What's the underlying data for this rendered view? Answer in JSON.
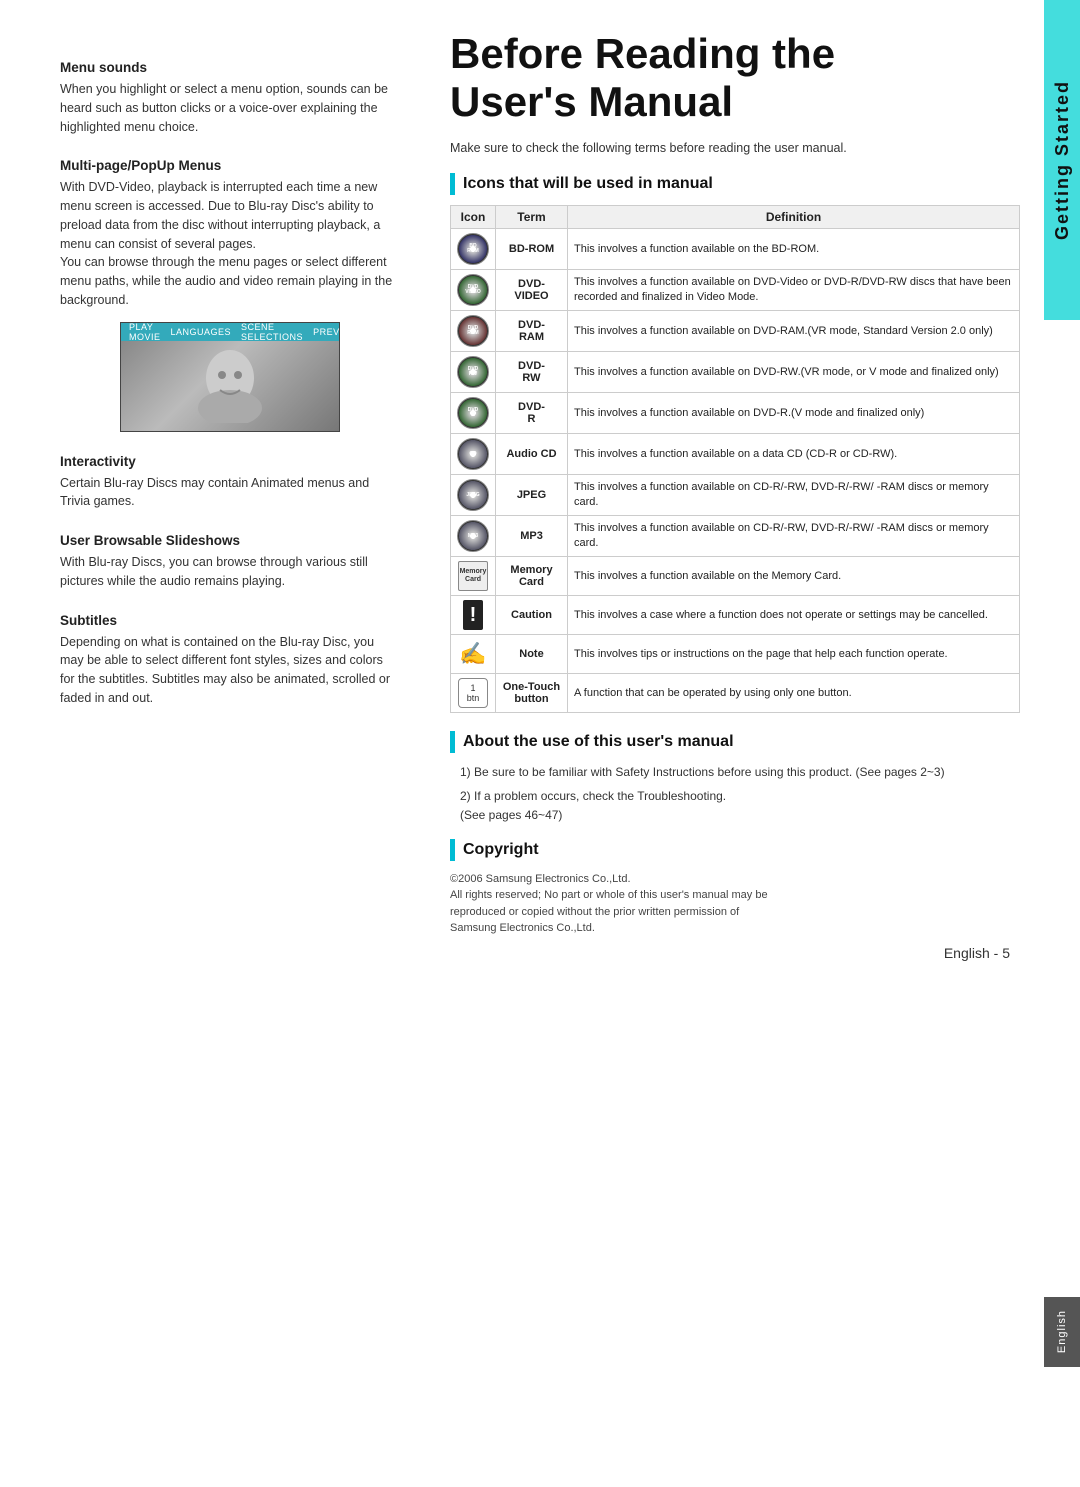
{
  "left": {
    "menu_sounds_title": "Menu sounds",
    "menu_sounds_text": "When you highlight or select a menu option, sounds can be heard such as button clicks or a voice-over explaining the highlighted menu choice.",
    "multipage_title": "Multi-page/PopUp Menus",
    "multipage_text": "With DVD-Video, playback is interrupted each time a new menu screen is accessed. Due to Blu-ray Disc's ability to preload data from the disc without interrupting playback, a menu can consist of several pages.\nYou can browse through the menu pages or select different menu paths, while the audio and video remain playing in the background.",
    "menu_bar_items": [
      "PLAY MOVIE",
      "LANGUAGES",
      "SCENE SELECTIONS",
      "PREVIEWS"
    ],
    "interactivity_title": "Interactivity",
    "interactivity_text": "Certain Blu-ray Discs may contain Animated menus and Trivia games.",
    "slideshows_title": "User Browsable Slideshows",
    "slideshows_text": "With Blu-ray Discs, you can browse through various still pictures while the audio remains playing.",
    "subtitles_title": "Subtitles",
    "subtitles_text": "Depending on what is contained on the Blu-ray Disc, you may be able to select different font styles, sizes and colors for the subtitles. Subtitles may also be animated, scrolled or faded in and out."
  },
  "right": {
    "page_title": "Before Reading the\nUser's Manual",
    "intro_text": "Make sure to check the following terms before reading the user manual.",
    "icons_section_title": "Icons that will be used in manual",
    "table_headers": [
      "Icon",
      "Term",
      "Definition"
    ],
    "table_rows": [
      {
        "icon_label": "BD-ROM",
        "term": "BD-ROM",
        "definition": "This involves a function available on the BD-ROM."
      },
      {
        "icon_label": "DVD-VIDEO",
        "term": "DVD-VIDEO",
        "definition": "This involves a function available on DVD-Video or DVD-R/DVD-RW discs that have been recorded and finalized in Video Mode."
      },
      {
        "icon_label": "DVD-RAM",
        "term": "DVD-\nRAM",
        "definition": "This involves a function available on DVD-RAM.(VR mode, Standard Version 2.0 only)"
      },
      {
        "icon_label": "DVD-RW",
        "term": "DVD-\nRW",
        "definition": "This involves a function available on DVD-RW.(VR mode, or V mode and finalized only)"
      },
      {
        "icon_label": "DVD-R",
        "term": "DVD-\nR",
        "definition": "This involves a function available on DVD-R.(V mode and finalized only)"
      },
      {
        "icon_label": "CD",
        "term": "Audio CD",
        "definition": "This involves a function available on a data CD (CD-R or CD-RW)."
      },
      {
        "icon_label": "JPEG",
        "term": "JPEG",
        "definition": "This involves a function available on CD-R/-RW, DVD-R/-RW/ -RAM discs or memory card."
      },
      {
        "icon_label": "MP3",
        "term": "MP3",
        "definition": "This involves a function available on CD-R/-RW, DVD-R/-RW/ -RAM discs or memory card."
      },
      {
        "icon_label": "Memory Card",
        "term": "Memory\nCard",
        "definition": "This involves a function available on the Memory Card."
      },
      {
        "icon_label": "!",
        "term": "Caution",
        "definition": "This involves a case where a function does not operate or settings may be cancelled."
      },
      {
        "icon_label": "note",
        "term": "Note",
        "definition": "This involves tips or instructions on the page that help each function operate."
      },
      {
        "icon_label": "1-touch",
        "term": "One-Touch\nbutton",
        "definition": "A function that can be operated by using only one button."
      }
    ],
    "about_title": "About the use of this user's manual",
    "about_items": [
      "1) Be sure to be familiar with Safety Instructions before using this product. (See pages 2~3)",
      "2) If a problem occurs, check the Troubleshooting.\n   (See pages 46~47)"
    ],
    "copyright_title": "Copyright",
    "copyright_text": "©2006 Samsung Electronics Co.,Ltd.\nAll rights reserved; No part or whole of this user's manual may be\nreproduced or copied without the prior written permission of\nSamsung Electronics Co.,Ltd.",
    "side_tab_label": "Getting Started",
    "english_tab_label": "English",
    "page_number": "English - 5"
  }
}
